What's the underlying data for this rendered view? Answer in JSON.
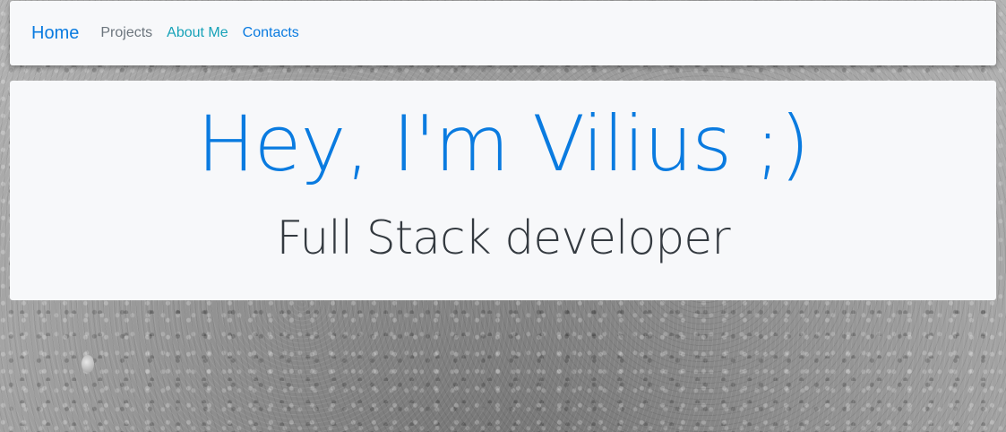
{
  "navbar": {
    "brand": "Home",
    "links": [
      {
        "label": "Projects"
      },
      {
        "label": "About Me"
      },
      {
        "label": "Contacts"
      }
    ]
  },
  "hero": {
    "title": "Hey, I'm Vilius ;)",
    "subtitle": "Full Stack developer"
  },
  "colors": {
    "primary": "#0a7be0",
    "teal": "#17a2b8",
    "muted": "#6c757d",
    "panel": "#f7f8fa",
    "subtitle": "#343a40"
  }
}
